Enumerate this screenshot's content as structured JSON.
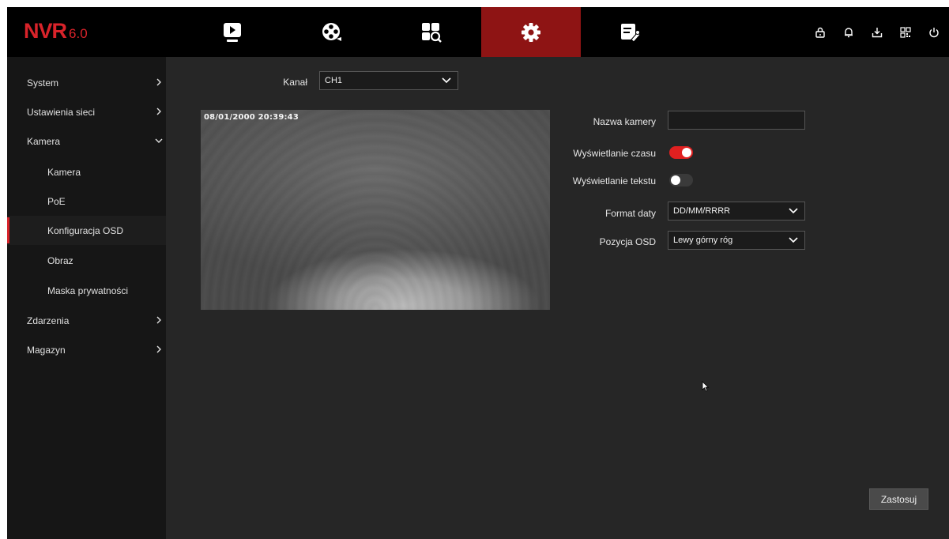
{
  "logo": {
    "main": "NVR",
    "version": "6.0"
  },
  "topnav": [
    {
      "name": "playback",
      "icon": "playback-icon",
      "active": false
    },
    {
      "name": "camera-reel",
      "icon": "film-reel-icon",
      "active": false
    },
    {
      "name": "search",
      "icon": "search-grid-icon",
      "active": false
    },
    {
      "name": "settings",
      "icon": "gear-icon",
      "active": true
    },
    {
      "name": "maintenance",
      "icon": "tools-checklist-icon",
      "active": false
    }
  ],
  "system_icons": [
    "lock-icon",
    "bell-icon",
    "download-icon",
    "qr-code-icon",
    "power-icon"
  ],
  "sidebar": {
    "items": [
      {
        "label": "System",
        "type": "top",
        "chevron": "right"
      },
      {
        "label": "Ustawienia sieci",
        "type": "top",
        "chevron": "right"
      },
      {
        "label": "Kamera",
        "type": "top",
        "chevron": "down"
      },
      {
        "label": "Kamera",
        "type": "sub"
      },
      {
        "label": "PoE",
        "type": "sub"
      },
      {
        "label": "Konfiguracja OSD",
        "type": "sub",
        "active": true
      },
      {
        "label": "Obraz",
        "type": "sub"
      },
      {
        "label": "Maska prywatności",
        "type": "sub"
      },
      {
        "label": "Zdarzenia",
        "type": "top",
        "chevron": "right"
      },
      {
        "label": "Magazyn",
        "type": "top",
        "chevron": "right"
      }
    ]
  },
  "channel": {
    "label": "Kanał",
    "value": "CH1"
  },
  "preview": {
    "osd_timestamp": "08/01/2000  20:39:43"
  },
  "form": {
    "camera_name": {
      "label": "Nazwa kamery",
      "value": ""
    },
    "show_time": {
      "label": "Wyświetlanie czasu",
      "on": true
    },
    "show_text": {
      "label": "Wyświetlanie tekstu",
      "on": false
    },
    "date_format": {
      "label": "Format daty",
      "value": "DD/MM/RRRR"
    },
    "osd_position": {
      "label": "Pozycja OSD",
      "value": "Lewy górny róg"
    }
  },
  "apply_label": "Zastosuj",
  "colors": {
    "accent": "#d8232a",
    "active_tab": "#8e1414",
    "toggle_on": "#e02020"
  }
}
